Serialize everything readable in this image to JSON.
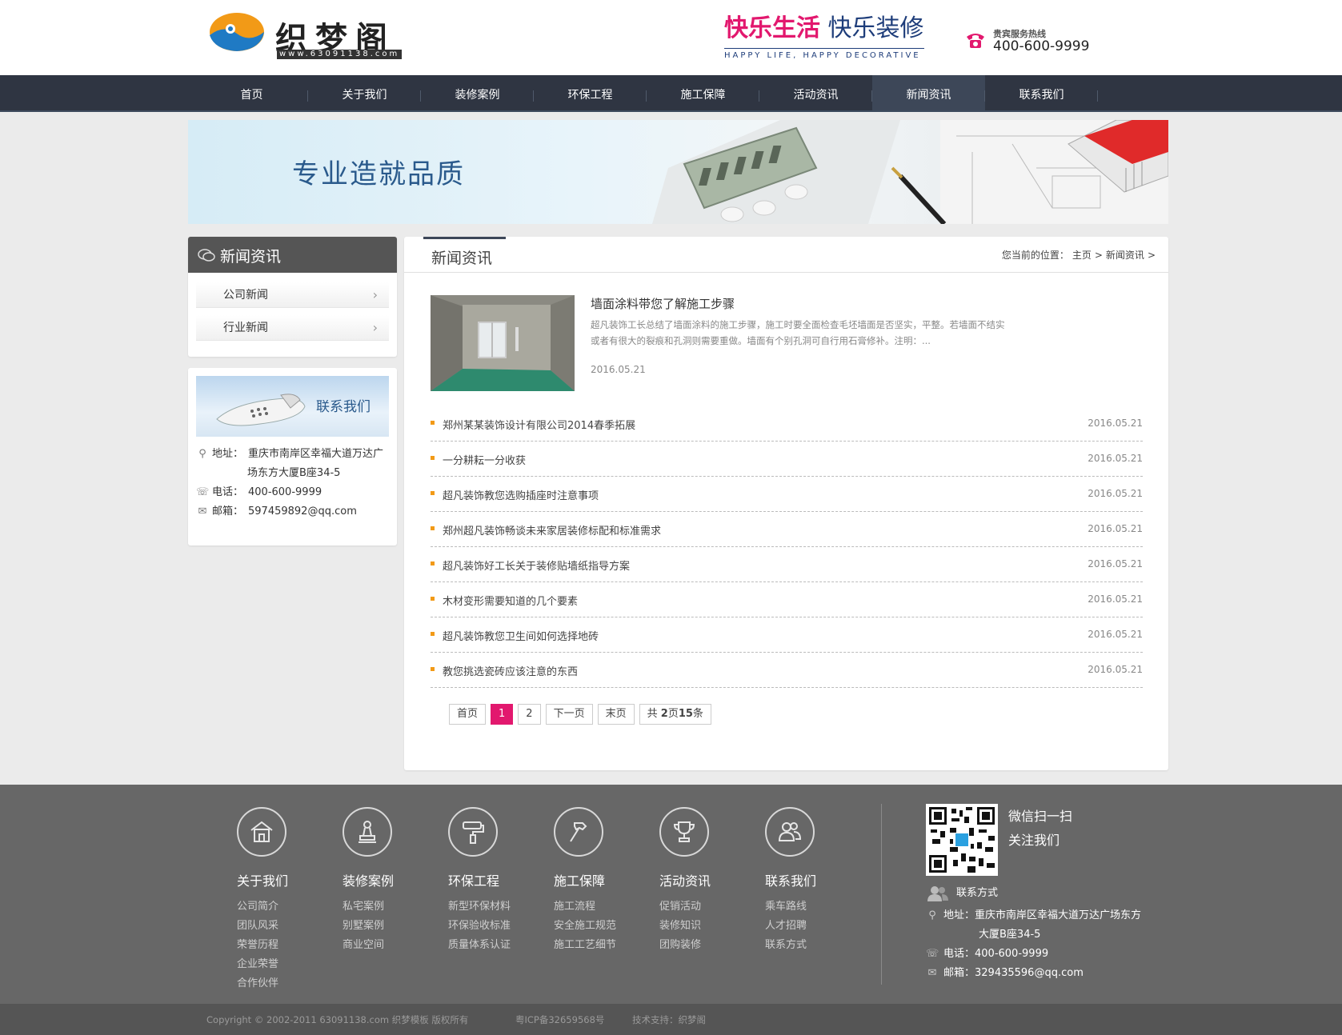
{
  "header": {
    "logo_text": "织梦阁",
    "logo_url": "www.63091138.com",
    "slogan_part1": "快乐生活",
    "slogan_part2": "快乐装修",
    "slogan_en": "HAPPY LIFE, HAPPY DECORATIVE",
    "hotline_label": "贵宾服务热线",
    "hotline_number": "400-600-9999"
  },
  "nav": {
    "items": [
      {
        "label": "首页"
      },
      {
        "label": "关于我们"
      },
      {
        "label": "装修案例"
      },
      {
        "label": "环保工程"
      },
      {
        "label": "施工保障"
      },
      {
        "label": "活动资讯"
      },
      {
        "label": "新闻资讯"
      },
      {
        "label": "联系我们"
      }
    ],
    "active_index": 6
  },
  "banner": {
    "text": "专业造就品质"
  },
  "sidebar": {
    "title": "新闻资讯",
    "items": [
      {
        "label": "公司新闻"
      },
      {
        "label": "行业新闻"
      }
    ],
    "contact": {
      "banner_title": "联系我们",
      "address_label": "地址：",
      "address_line1": "重庆市南岸区幸福大道万达广",
      "address_line2": "场东方大厦B座34-5",
      "phone_label": "电话：",
      "phone": "400-600-9999",
      "email_label": "邮箱：",
      "email": "597459892@qq.com"
    }
  },
  "main": {
    "title": "新闻资讯",
    "breadcrumb": {
      "prefix": "您当前的位置：",
      "home": "主页",
      "sep": ">",
      "current": "新闻资讯"
    },
    "feature": {
      "title": "墙面涂料带您了解施工步骤",
      "desc": "超凡装饰工长总结了墙面涂料的施工步骤，施工时要全面检查毛坯墙面是否坚实，平整。若墙面不结实或者有很大的裂痕和孔洞则需要重做。墙面有个别孔洞可自行用石膏修补。注明：...",
      "date": "2016.05.21"
    },
    "news": [
      {
        "title": "郑州某某装饰设计有限公司2014春季拓展",
        "date": "2016.05.21"
      },
      {
        "title": "一分耕耘一分收获",
        "date": "2016.05.21"
      },
      {
        "title": "超凡装饰教您选购插座时注意事项",
        "date": "2016.05.21"
      },
      {
        "title": "郑州超凡装饰畅谈未来家居装修标配和标准需求",
        "date": "2016.05.21"
      },
      {
        "title": "超凡装饰好工长关于装修贴墙纸指导方案",
        "date": "2016.05.21"
      },
      {
        "title": "木材变形需要知道的几个要素",
        "date": "2016.05.21"
      },
      {
        "title": "超凡装饰教您卫生间如何选择地砖",
        "date": "2016.05.21"
      },
      {
        "title": "教您挑选瓷砖应该注意的东西",
        "date": "2016.05.21"
      }
    ],
    "pager": {
      "first": "首页",
      "page1": "1",
      "page2": "2",
      "next": "下一页",
      "last": "末页",
      "total_prefix": "共",
      "total_pages": "2",
      "total_mid": "页",
      "total_items": "15",
      "total_suffix": "条"
    }
  },
  "footer": {
    "columns": [
      {
        "icon": "house-icon",
        "title": "关于我们",
        "links": [
          "公司简介",
          "团队风采",
          "荣誉历程",
          "企业荣誉",
          "合作伙伴"
        ]
      },
      {
        "icon": "stamp-icon",
        "title": "装修案例",
        "links": [
          "私宅案例",
          "别墅案例",
          "商业空间"
        ]
      },
      {
        "icon": "paint-roller-icon",
        "title": "环保工程",
        "links": [
          "新型环保材料",
          "环保验收标准",
          "质量体系认证"
        ]
      },
      {
        "icon": "hammer-icon",
        "title": "施工保障",
        "links": [
          "施工流程",
          "安全施工规范",
          "施工工艺细节"
        ]
      },
      {
        "icon": "trophy-icon",
        "title": "活动资讯",
        "links": [
          "促销活动",
          "装修知识",
          "团购装修"
        ]
      },
      {
        "icon": "people-icon",
        "title": "联系我们",
        "links": [
          "乘车路线",
          "人才招聘",
          "联系方式"
        ]
      }
    ],
    "qr_text1": "微信扫一扫",
    "qr_text2": "关注我们",
    "contact_title": "联系方式",
    "address_label": "地址：",
    "address_line1": "重庆市南岸区幸福大道万达广场东方",
    "address_line2": "大厦B座34-5",
    "phone_label": "电话：",
    "phone": "400-600-9999",
    "email_label": "邮箱：",
    "email": "329435596@qq.com",
    "copyright": "Copyright © 2002-2011 63091138.com 织梦模板 版权所有",
    "icp": "粤ICP备32659568号",
    "support": "技术支持：织梦阁"
  },
  "colors": {
    "nav_bg": "#2f3542",
    "accent_pink": "#e2186e",
    "bullet_orange": "#f29a17",
    "footer_bg": "#676767",
    "copyright_bg": "#555555"
  }
}
